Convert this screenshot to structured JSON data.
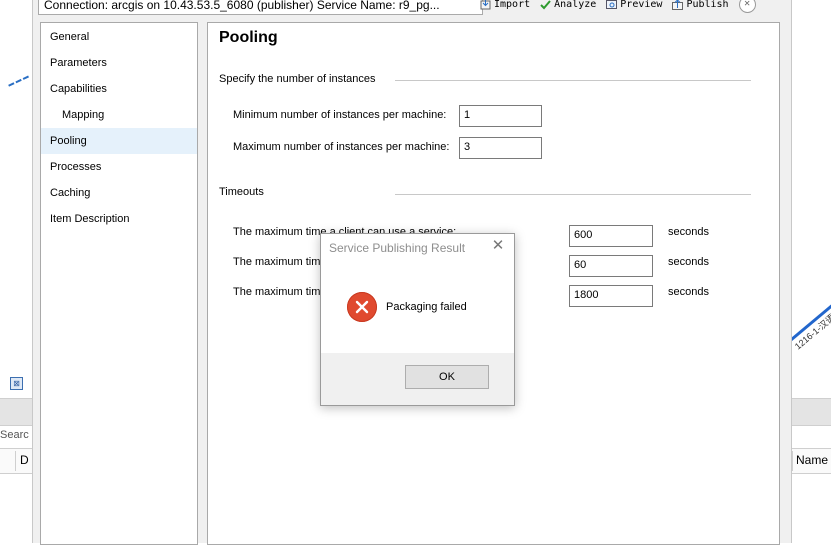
{
  "editor": {
    "connection_text": "Connection: arcgis on 10.43.53.5_6080 (publisher)   Service Name: r9_pg...",
    "toolbar": {
      "import_label": "Import",
      "analyze_label": "Analyze",
      "preview_label": "Preview",
      "publish_label": "Publish",
      "close_glyph": "✕"
    },
    "nav": {
      "items": [
        {
          "label": "General"
        },
        {
          "label": "Parameters"
        },
        {
          "label": "Capabilities"
        },
        {
          "label": "Mapping"
        },
        {
          "label": "Pooling"
        },
        {
          "label": "Processes"
        },
        {
          "label": "Caching"
        },
        {
          "label": "Item Description"
        }
      ],
      "selected": "Pooling"
    },
    "pooling": {
      "title": "Pooling",
      "instances_section": "Specify the number of instances",
      "min_label": "Minimum number of instances per machine:",
      "min_value": "1",
      "max_label": "Maximum number of instances per machine:",
      "max_value": "3",
      "timeouts_section": "Timeouts",
      "timeout_rows": [
        {
          "label": "The maximum time a client can use a service:",
          "value": "600",
          "unit": "seconds"
        },
        {
          "label": "The maximum time",
          "value": "60",
          "unit": "seconds"
        },
        {
          "label": "The maximum time",
          "value": "1800",
          "unit": "seconds"
        }
      ]
    }
  },
  "dialog": {
    "title": "Service Publishing Result",
    "close_glyph": "✕",
    "message": "Packaging failed",
    "ok_label": "OK"
  },
  "background": {
    "search_text": "Searc",
    "left_column_header": "D",
    "right_column_header": "Name",
    "right_map_text": "1216-1-汉语"
  },
  "colors": {
    "selection": "#e5f1fb",
    "error_red": "#e04a2f",
    "accent_blue": "#2266cc"
  }
}
